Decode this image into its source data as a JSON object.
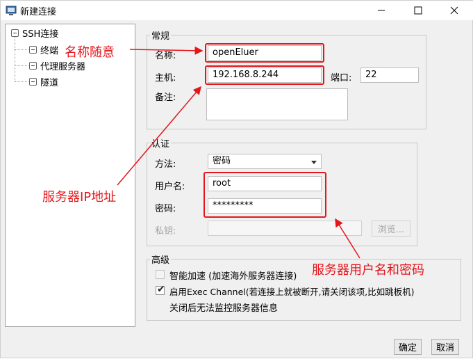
{
  "window": {
    "title": "新建连接"
  },
  "tree": {
    "root": "SSH连接",
    "children": [
      "终端",
      "代理服务器",
      "隧道"
    ]
  },
  "general": {
    "legend": "常规",
    "name_label": "名称:",
    "name_value": "openEluer",
    "host_label": "主机:",
    "host_value": "192.168.8.244",
    "port_label": "端口:",
    "port_value": "22",
    "note_label": "备注:",
    "note_value": ""
  },
  "auth": {
    "legend": "认证",
    "method_label": "方法:",
    "method_value": "密码",
    "user_label": "用户名:",
    "user_value": "root",
    "password_label": "密码:",
    "password_value": "*********",
    "key_label": "私钥:",
    "key_value": "",
    "browse_label": "浏览..."
  },
  "advanced": {
    "legend": "高级",
    "accel_label": "智能加速 (加速海外服务器连接)",
    "accel_checked": false,
    "exec_label": "启用Exec Channel(若连接上就被断开,请关闭该项,比如跳板机)",
    "exec_checked": true,
    "exec_note": "关闭后无法监控服务器信息"
  },
  "buttons": {
    "ok": "确定",
    "cancel": "取消"
  },
  "annotations": {
    "name": "名称随意",
    "ip": "服务器IP地址",
    "cred": "服务器用户名和密码"
  },
  "colors": {
    "annotation": "#e4161c"
  }
}
